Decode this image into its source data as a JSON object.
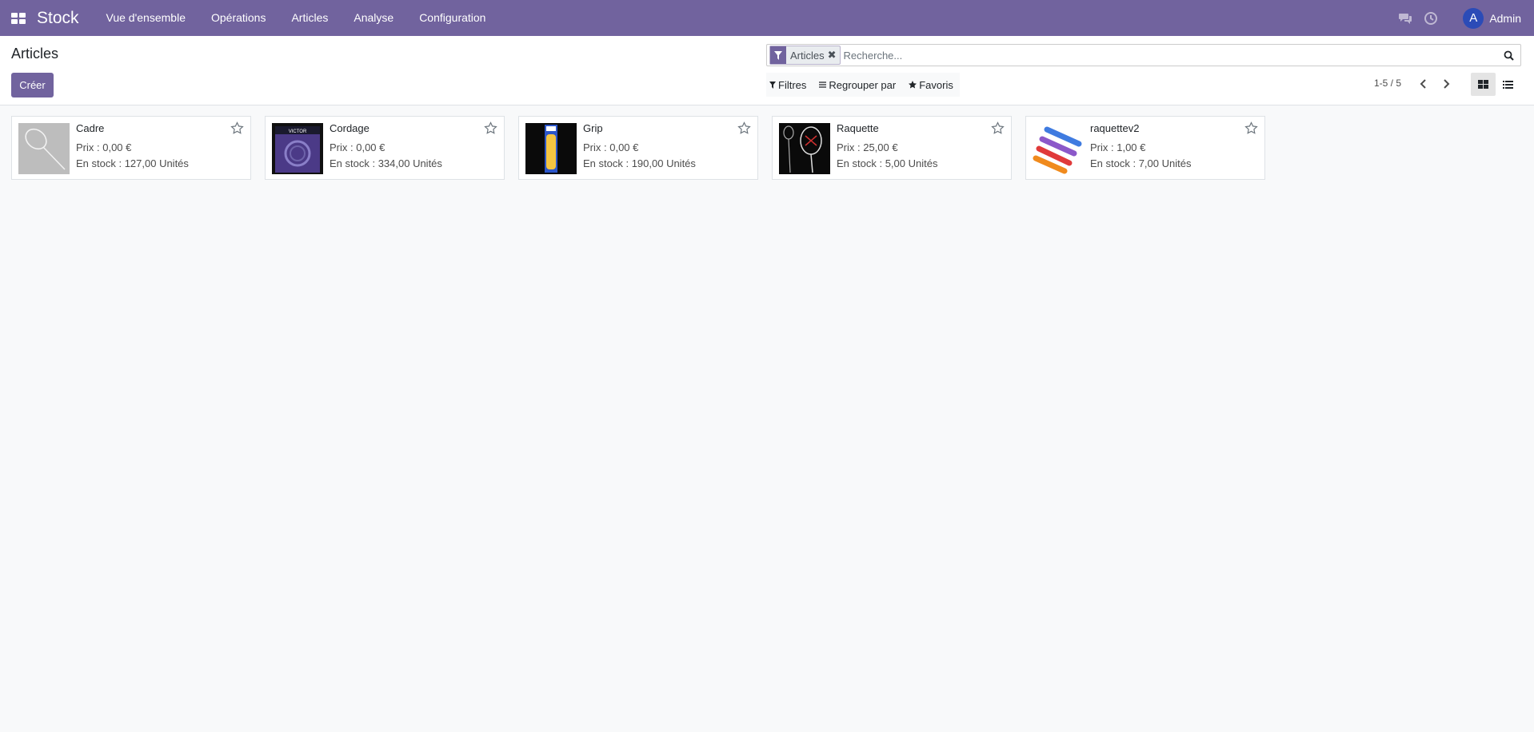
{
  "navbar": {
    "brand": "Stock",
    "menu": [
      "Vue d'ensemble",
      "Opérations",
      "Articles",
      "Analyse",
      "Configuration"
    ],
    "icons": [
      "chat-icon",
      "clock-icon"
    ],
    "user": {
      "initial": "A",
      "name": "Admin"
    }
  },
  "control_panel": {
    "title": "Articles",
    "create_label": "Créer",
    "search": {
      "facet_label": "Articles",
      "placeholder": "Recherche..."
    },
    "filters": {
      "filter_label": "Filtres",
      "group_label": "Regrouper par",
      "favorites_label": "Favoris"
    },
    "pager": "1-5 / 5"
  },
  "products": [
    {
      "name": "Cadre",
      "price": "Prix : 0,00 €",
      "stock": "En stock : 127,00 Unités",
      "image": "racket-frame"
    },
    {
      "name": "Cordage",
      "price": "Prix : 0,00 €",
      "stock": "En stock : 334,00 Unités",
      "image": "string-pack"
    },
    {
      "name": "Grip",
      "price": "Prix : 0,00 €",
      "stock": "En stock : 190,00 Unités",
      "image": "grip-pack"
    },
    {
      "name": "Raquette",
      "price": "Prix : 25,00 €",
      "stock": "En stock : 5,00 Unités",
      "image": "racket"
    },
    {
      "name": "raquettev2",
      "price": "Prix : 1,00 €",
      "stock": "En stock : 7,00 Unités",
      "image": "grips-colored"
    }
  ],
  "colors": {
    "brand": "#71639e",
    "avatar": "#2b4bb7"
  }
}
